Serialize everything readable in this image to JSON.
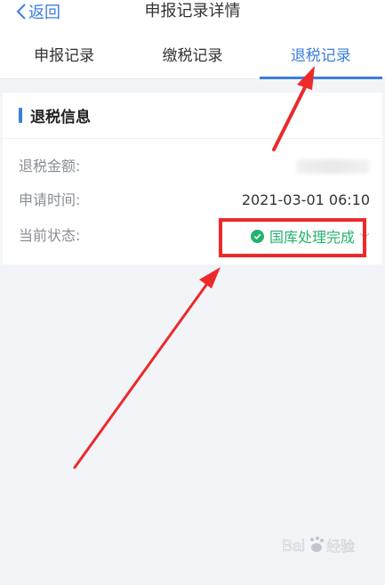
{
  "header": {
    "back_label": "返回",
    "title": "申报记录详情"
  },
  "tabs": [
    {
      "label": "申报记录",
      "active": false
    },
    {
      "label": "缴税记录",
      "active": false
    },
    {
      "label": "退税记录",
      "active": true
    }
  ],
  "section": {
    "title": "退税信息"
  },
  "rows": {
    "amount": {
      "label": "退税金额:",
      "value": ""
    },
    "apply_time": {
      "label": "申请时间:",
      "value": "2021-03-01 06:10"
    },
    "status": {
      "label": "当前状态:",
      "value": "国库处理完成"
    }
  },
  "colors": {
    "accent": "#3b7ee0",
    "status_green": "#23b26d",
    "annotation_red": "#ec2a2a"
  },
  "watermark": {
    "text": "Bai经验"
  }
}
